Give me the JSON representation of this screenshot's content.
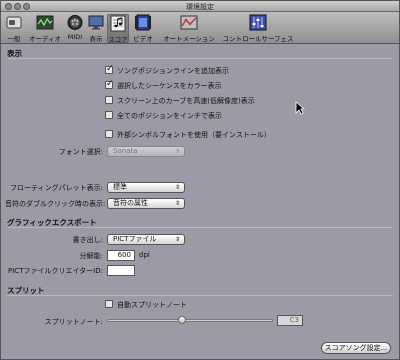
{
  "window": {
    "title": "環境設定"
  },
  "toolbar": {
    "items": [
      {
        "label": "一般",
        "icon": "switch-icon",
        "active": false
      },
      {
        "label": "オーディオ",
        "icon": "audio-icon",
        "active": false
      },
      {
        "label": "MIDI",
        "icon": "midi-icon",
        "active": false
      },
      {
        "label": "表示",
        "icon": "display-icon",
        "active": false
      },
      {
        "label": "スコア",
        "icon": "score-icon",
        "active": true
      },
      {
        "label": "ビデオ",
        "icon": "video-icon",
        "active": false
      },
      {
        "label": "オートメーション",
        "icon": "automation-icon",
        "active": false
      },
      {
        "label": "コントロールサーフェス",
        "icon": "control-surface-icon",
        "active": false
      }
    ]
  },
  "display_section": {
    "header": "表示",
    "checkboxes": [
      {
        "label": "ソングポジションラインを追加表示",
        "checked": true
      },
      {
        "label": "選択したシーケンスをカラー表示",
        "checked": true
      },
      {
        "label": "スクリーン上のカーブを高速(低解像度)表示",
        "checked": false
      },
      {
        "label": "全てのポジションをインチで表示",
        "checked": false
      },
      {
        "label": "外部シンボルフォントを使用（要インストール）",
        "checked": false
      }
    ],
    "font_select": {
      "label": "フォント選択:",
      "value": "Sonata"
    },
    "floating_palette": {
      "label": "フローティングパレット表示:",
      "value": "標準"
    },
    "note_double_click": {
      "label": "音符のダブルクリック時の表示:",
      "value": "音符の属性"
    }
  },
  "graphic_export": {
    "header": "グラフィックエクスポート",
    "write_out": {
      "label": "書き出し:",
      "value": "PICTファイル"
    },
    "resolution": {
      "label": "分解能:",
      "value": "600",
      "unit": "dpi"
    },
    "creator_id": {
      "label": "PICTファイルクリエイターID:",
      "value": ""
    }
  },
  "split": {
    "header": "スプリット",
    "auto_split": {
      "label": "自動スプリットノート",
      "checked": false
    },
    "split_note": {
      "label": "スプリットノート:",
      "value": "C3",
      "slider_level": 0.45
    }
  },
  "footer": {
    "score_song_button": "スコアソング設定..."
  }
}
